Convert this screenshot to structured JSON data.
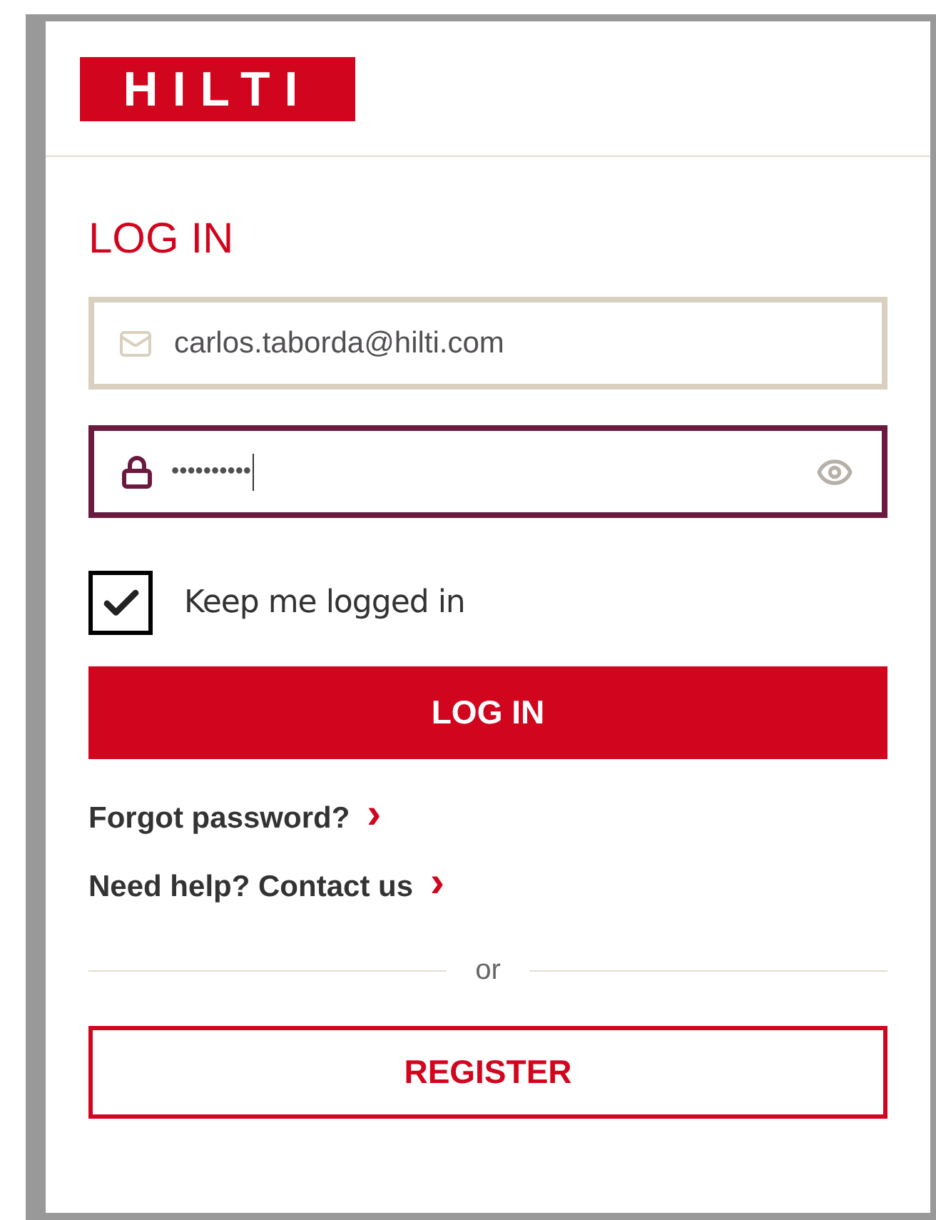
{
  "logo": {
    "text": "HILTI"
  },
  "title": "LOG IN",
  "email_field": {
    "value": "carlos.taborda@hilti.com"
  },
  "password_field": {
    "value": "••••••••••",
    "focused": true
  },
  "keep_logged_in": {
    "label": "Keep me logged in",
    "checked": true
  },
  "login_button": "LOG IN",
  "links": [
    {
      "label": "Forgot password?",
      "arrow": "›"
    },
    {
      "label": "Need help? Contact us",
      "arrow": "›"
    }
  ],
  "divider_text": "or",
  "register_button": "REGISTER"
}
